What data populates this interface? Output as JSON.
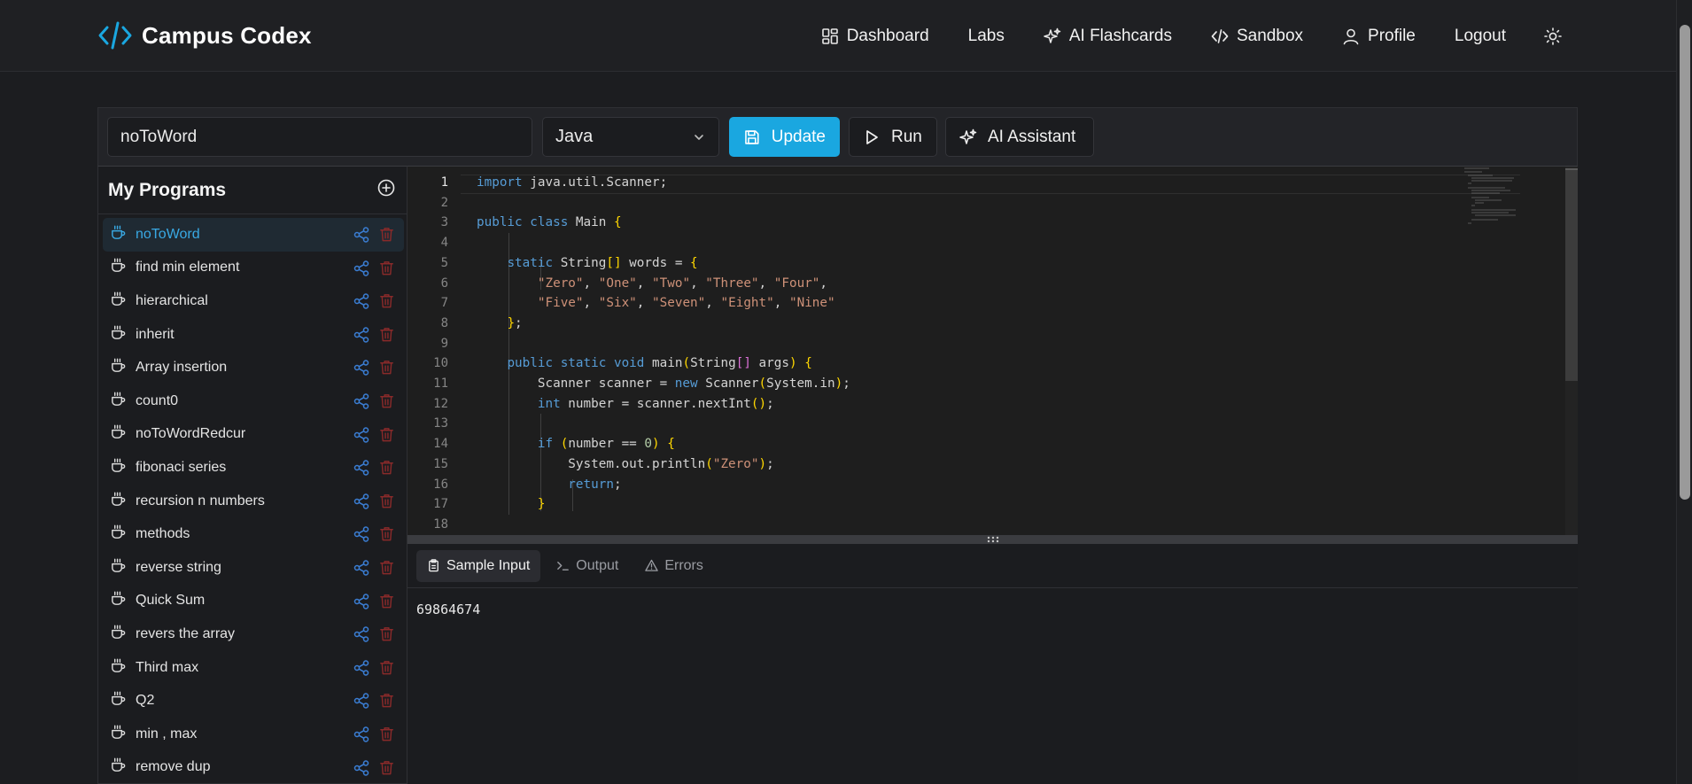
{
  "app": {
    "brand": "Campus Codex",
    "accent_color": "#1aa7e0"
  },
  "nav": {
    "items": [
      {
        "label": "Dashboard",
        "icon": "dashboard-icon"
      },
      {
        "label": "Labs",
        "icon": ""
      },
      {
        "label": "AI Flashcards",
        "icon": "sparkles-icon"
      },
      {
        "label": "Sandbox",
        "icon": "code-icon"
      },
      {
        "label": "Profile",
        "icon": "user-icon"
      },
      {
        "label": "Logout",
        "icon": ""
      }
    ],
    "theme_toggle_icon": "sun-icon"
  },
  "toolbar": {
    "program_name_value": "noToWord",
    "language_selected": "Java",
    "update_label": "Update",
    "run_label": "Run",
    "ai_label": "AI Assistant"
  },
  "sidebar": {
    "title": "My Programs",
    "items": [
      {
        "label": "noToWord"
      },
      {
        "label": "find min element"
      },
      {
        "label": "hierarchical"
      },
      {
        "label": "inherit"
      },
      {
        "label": "Array insertion"
      },
      {
        "label": "count0"
      },
      {
        "label": "noToWordRedcur"
      },
      {
        "label": "fibonaci series"
      },
      {
        "label": "recursion n numbers"
      },
      {
        "label": "methods"
      },
      {
        "label": "reverse string"
      },
      {
        "label": "Quick Sum"
      },
      {
        "label": "revers the array"
      },
      {
        "label": "Third max"
      },
      {
        "label": "Q2"
      },
      {
        "label": "min , max"
      },
      {
        "label": "remove dup"
      }
    ]
  },
  "editor": {
    "line_numbers": [
      "1",
      "2",
      "3",
      "4",
      "5",
      "6",
      "7",
      "8",
      "9",
      "10",
      "11",
      "12",
      "13",
      "14",
      "15",
      "16",
      "17",
      "18"
    ],
    "lines": [
      "import java.util.Scanner;",
      "",
      "public class Main {",
      "",
      "    static String[] words = {",
      "        \"Zero\", \"One\", \"Two\", \"Three\", \"Four\",",
      "        \"Five\", \"Six\", \"Seven\", \"Eight\", \"Nine\"",
      "    };",
      "",
      "    public static void main(String[] args) {",
      "        Scanner scanner = new Scanner(System.in);",
      "        int number = scanner.nextInt();",
      "",
      "        if (number == 0) {",
      "            System.out.println(\"Zero\");",
      "            return;",
      "        }",
      ""
    ]
  },
  "io": {
    "tabs": [
      {
        "label": "Sample Input",
        "icon": "clipboard-icon"
      },
      {
        "label": "Output",
        "icon": "terminal-icon"
      },
      {
        "label": "Errors",
        "icon": "warning-icon"
      }
    ],
    "sample_input": "69864674"
  }
}
